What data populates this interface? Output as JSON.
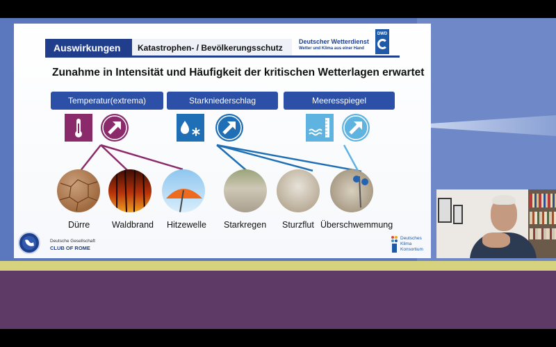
{
  "colors": {
    "slide_header_blue": "#213e8d",
    "category_blue": "#2c50a8",
    "temperature_purple": "#8b2a6b",
    "precip_blue": "#1e6fb5",
    "sea_blue": "#5fb3e0",
    "yellow_strip": "#d6d27e",
    "purple_band": "#5e3a66"
  },
  "slide": {
    "header": {
      "tab_label": "Auswirkungen",
      "subtitle": "Katastrophen- / Bevölkerungsschutz",
      "org_name": "Deutscher Wetterdienst",
      "org_tagline": "Wetter und Klima aus einer Hand",
      "org_logo_text": "DWD"
    },
    "headline": "Zunahme in Intensität und Häufigkeit der kritischen Wetterlagen erwartet",
    "categories": [
      {
        "label": "Temperatur(extrema)",
        "icon": "thermometer-icon",
        "trend": "increase-arrow-icon"
      },
      {
        "label": "Starkniederschlag",
        "icon": "rain-snow-icon",
        "trend": "increase-arrow-icon"
      },
      {
        "label": "Meeresspiegel",
        "icon": "sea-level-icon",
        "trend": "increase-arrow-icon"
      }
    ],
    "impacts": [
      {
        "label": "Dürre"
      },
      {
        "label": "Waldbrand"
      },
      {
        "label": "Hitzewelle"
      },
      {
        "label": "Starkregen"
      },
      {
        "label": "Sturzflut"
      },
      {
        "label": "Überschwemmung"
      }
    ],
    "footer": {
      "club_small": "Deutsche Gesellschaft",
      "club_big": "CLUB OF ROME",
      "club_logo_text": "THE CLUB OF ROME",
      "dkk_line1": "Deutsches",
      "dkk_line2": "Klima",
      "dkk_line3": "Konsortium",
      "dkk_mark": "DKK"
    }
  },
  "video_tile": {
    "participant": "speaker-video"
  }
}
